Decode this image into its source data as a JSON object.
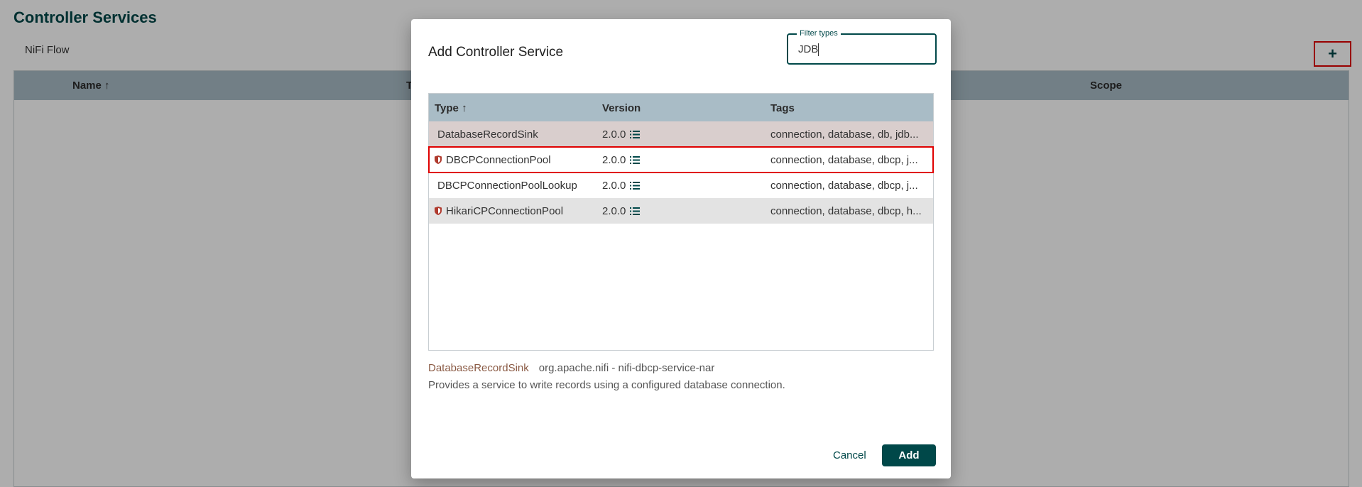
{
  "background": {
    "title": "Controller Services",
    "breadcrumb": "NiFi Flow",
    "add_button": "+",
    "table": {
      "columns": [
        "Name ↑",
        "T",
        "Scope"
      ]
    }
  },
  "dialog": {
    "title": "Add Controller Service",
    "filter": {
      "label": "Filter types",
      "value": "JDB"
    },
    "table": {
      "columns": {
        "type": "Type ↑",
        "version": "Version",
        "tags": "Tags"
      },
      "rows": [
        {
          "type": "DatabaseRecordSink",
          "version": "2.0.0",
          "tags": "connection, database, db, jdb...",
          "restricted": false,
          "state": "selected"
        },
        {
          "type": "DBCPConnectionPool",
          "version": "2.0.0",
          "tags": "connection, database, dbcp, j...",
          "restricted": true,
          "state": "highlighted"
        },
        {
          "type": "DBCPConnectionPoolLookup",
          "version": "2.0.0",
          "tags": "connection, database, dbcp, j...",
          "restricted": false,
          "state": "normal"
        },
        {
          "type": "HikariCPConnectionPool",
          "version": "2.0.0",
          "tags": "connection, database, dbcp, h...",
          "restricted": true,
          "state": "shaded"
        }
      ]
    },
    "description": {
      "type_name": "DatabaseRecordSink",
      "bundle": "org.apache.nifi - nifi-dbcp-service-nar",
      "text": "Provides a service to write records using a configured database connection."
    },
    "buttons": {
      "cancel": "Cancel",
      "add": "Add"
    }
  },
  "colors": {
    "primary": "#004849",
    "header_bg": "#a9bcc6",
    "selected_row": "#d9cecd",
    "shaded_row": "#e3e3e3",
    "highlight": "#e00000",
    "restricted_icon": "#b03a2e"
  }
}
